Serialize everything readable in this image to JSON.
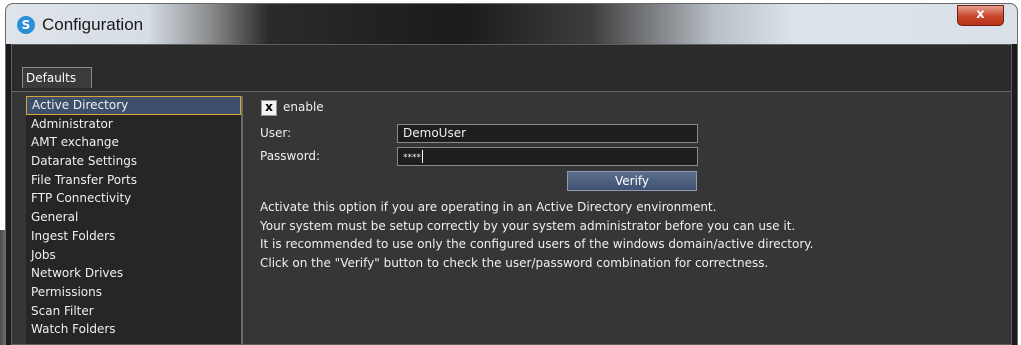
{
  "window": {
    "title": "Configuration",
    "close_glyph": "x",
    "app_icon_glyph": "S"
  },
  "tabs": [
    {
      "label": "Defaults"
    }
  ],
  "sidebar": {
    "items": [
      {
        "label": "Active Directory",
        "selected": true
      },
      {
        "label": "Administrator"
      },
      {
        "label": "AMT exchange"
      },
      {
        "label": "Datarate Settings"
      },
      {
        "label": "File Transfer Ports"
      },
      {
        "label": "FTP Connectivity"
      },
      {
        "label": "General"
      },
      {
        "label": "Ingest Folders"
      },
      {
        "label": "Jobs"
      },
      {
        "label": "Network Drives"
      },
      {
        "label": "Permissions"
      },
      {
        "label": "Scan Filter"
      },
      {
        "label": "Watch Folders"
      }
    ]
  },
  "active_directory": {
    "enable": {
      "checked": true,
      "mark": "x",
      "label": "enable"
    },
    "user": {
      "label": "User:",
      "value": "DemoUser"
    },
    "password": {
      "label": "Password:",
      "value": "****"
    },
    "verify_label": "Verify",
    "help_lines": [
      "Activate this option if you are operating in an Active Directory environment.",
      "Your system must be setup correctly by your system administrator before you can use it.",
      "It is recommended to use only the configured users of the windows domain/active directory.",
      "Click on the \"Verify\" button to check the user/password combination for correctness."
    ]
  }
}
